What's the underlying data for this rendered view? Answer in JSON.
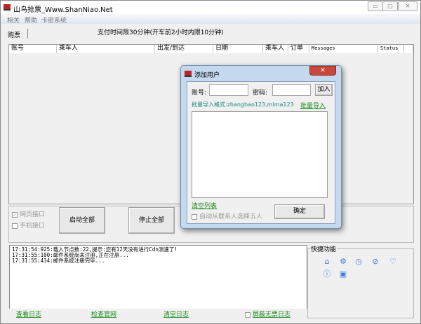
{
  "window": {
    "title": "山鸟抢票_Www.ShanNiao.Net"
  },
  "menu": [
    "相关",
    "帮助",
    "卡密系统"
  ],
  "tab": "购票",
  "notice": "支付时间限30分钟(开车前2小时内限10分钟)",
  "table": {
    "columns": [
      "账号",
      "乘车人",
      "出发/到达",
      "日期",
      "乘车人",
      "订单",
      "Messages",
      "Status"
    ]
  },
  "options": {
    "web_api": "网页接口",
    "web_api_checked": true,
    "mobile_api": "手机接口",
    "mobile_api_checked": false,
    "start_all": "启动全部",
    "stop_all": "停止全部"
  },
  "log": [
    "17:31:54:925:载入节点数:22,提示:您有12天没有进行Cdn测速了!",
    "17:31:55:100:邮件系统尚未注册,正在注册...",
    "17:31:55:434:邮件系统注册完毕..."
  ],
  "links": {
    "view_log": "查看日志",
    "check_site": "检查官网",
    "clear_log": "清空日志",
    "hide_noticket_log": "屏蔽无票日志"
  },
  "quick": {
    "title": "快捷功能",
    "icons": [
      "home-icon",
      "settings-icon",
      "clock-icon",
      "compass-icon",
      "heart-icon",
      "info-icon",
      "contact-icon"
    ]
  },
  "dialog": {
    "title": "添加用户",
    "account_label": "账号:",
    "account_value": "",
    "password_label": "密码:",
    "password_value": "",
    "add": "加入",
    "batch_format": "批量导入格式:zhanghao123,mima123",
    "batch_import": "批量导入",
    "clear_list": "清空列表",
    "auto_select": "自动从联系人选择五人",
    "confirm": "确定"
  }
}
